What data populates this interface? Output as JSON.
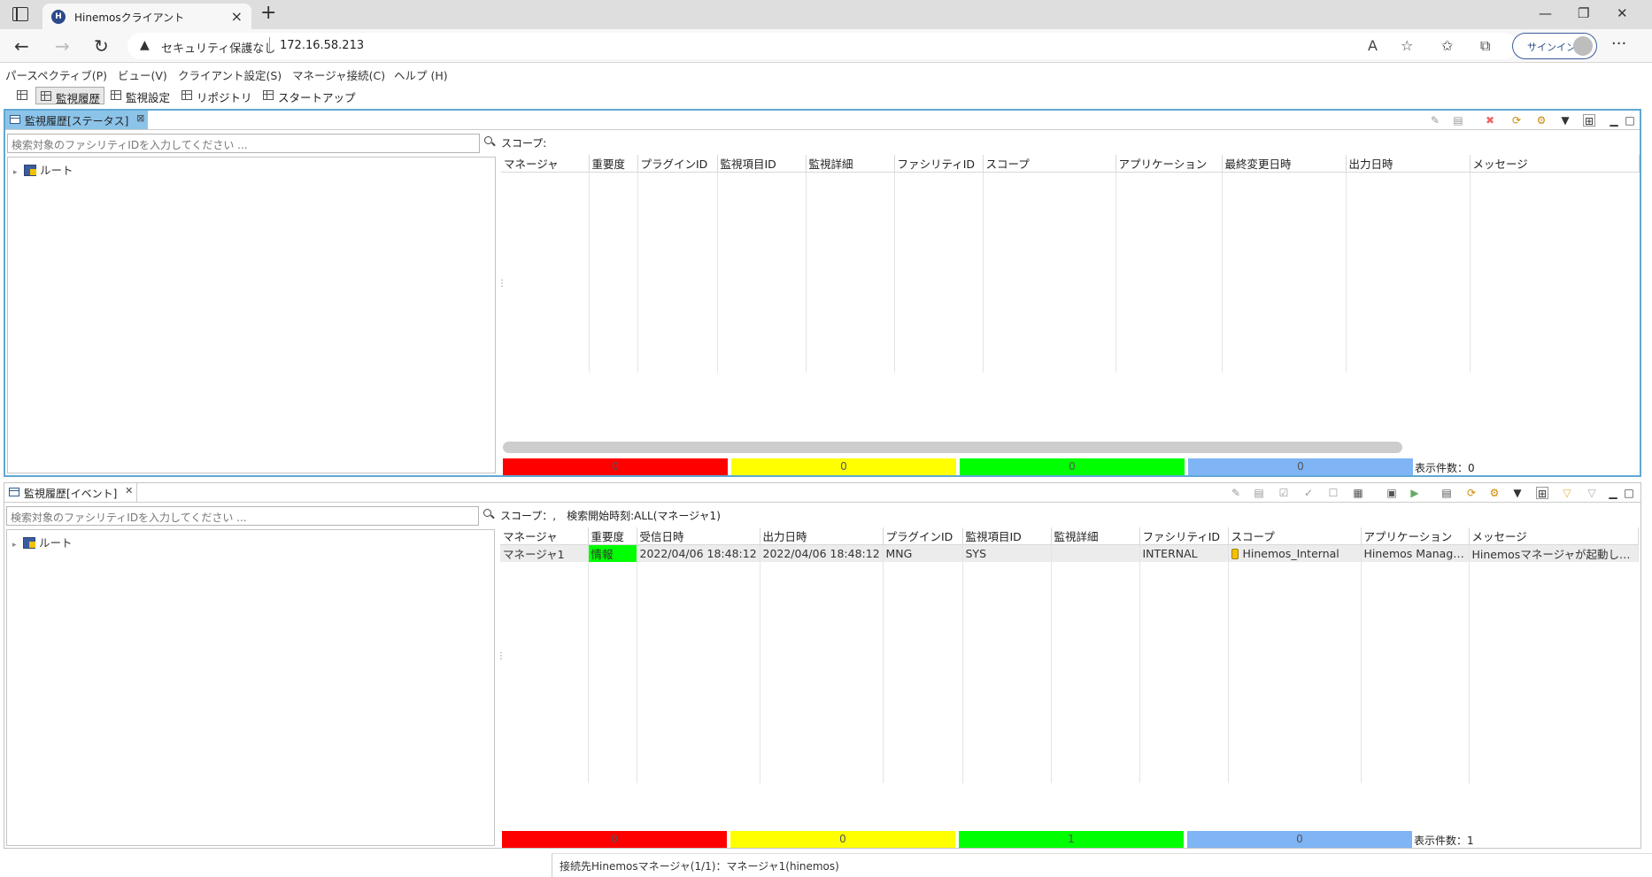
{
  "browser": {
    "tab_title": "Hinemosクライアント",
    "security_label": "セキュリティ保護なし",
    "url": "172.16.58.213",
    "signin_label": "サインイン"
  },
  "menu": [
    "パースペクティブ(P)",
    "ビュー(V)",
    "クライアント設定(S)",
    "マネージャ接続(C)",
    "ヘルプ (H)"
  ],
  "perspectives": [
    "監視履歴",
    "監視設定",
    "リポジトリ",
    "スタートアップ"
  ],
  "search_placeholder": "検索対象のファシリティIDを入力してください ...",
  "tree_root": "ルート",
  "status_view": {
    "title": "監視履歴[ステータス]",
    "scope_label": "スコープ:",
    "columns": [
      "マネージャ",
      "重要度",
      "プラグインID",
      "監視項目ID",
      "監視詳細",
      "ファシリティID",
      "スコープ",
      "アプリケーション",
      "最終変更日時",
      "出力日時",
      "メッセージ"
    ],
    "counts": {
      "critical": "0",
      "warning": "0",
      "info": "0",
      "unknown": "0"
    },
    "total_label": "表示件数：0"
  },
  "event_view": {
    "title": "監視履歴[イベント]",
    "scope_label": "スコープ：,　検索開始時刻:ALL(マネージャ1)",
    "columns": [
      "マネージャ",
      "重要度",
      "受信日時",
      "出力日時",
      "プラグインID",
      "監視項目ID",
      "監視詳細",
      "ファシリティID",
      "スコープ",
      "アプリケーション",
      "メッセージ"
    ],
    "rows": [
      {
        "manager": "マネージャ1",
        "severity": "情報",
        "received": "2022/04/06 18:48:12",
        "output": "2022/04/06 18:48:12",
        "plugin": "MNG",
        "monitor": "SYS",
        "detail": "",
        "facility": "INTERNAL",
        "scope": "Hinemos_Internal",
        "application": "Hinemos Manage...",
        "message": "Hinemosマネージャが起動しま..."
      }
    ],
    "counts": {
      "critical": "0",
      "warning": "0",
      "info": "1",
      "unknown": "0"
    },
    "total_label": "表示件数：1"
  },
  "statusbar_text": "接続先Hinemosマネージャ(1/1)：マネージャ1(hinemos)",
  "colors": {
    "critical": "#ff0000",
    "warning": "#ffff00",
    "info": "#00ff00",
    "unknown": "#7fb4f5",
    "active_tab": "#8cc3e9"
  }
}
